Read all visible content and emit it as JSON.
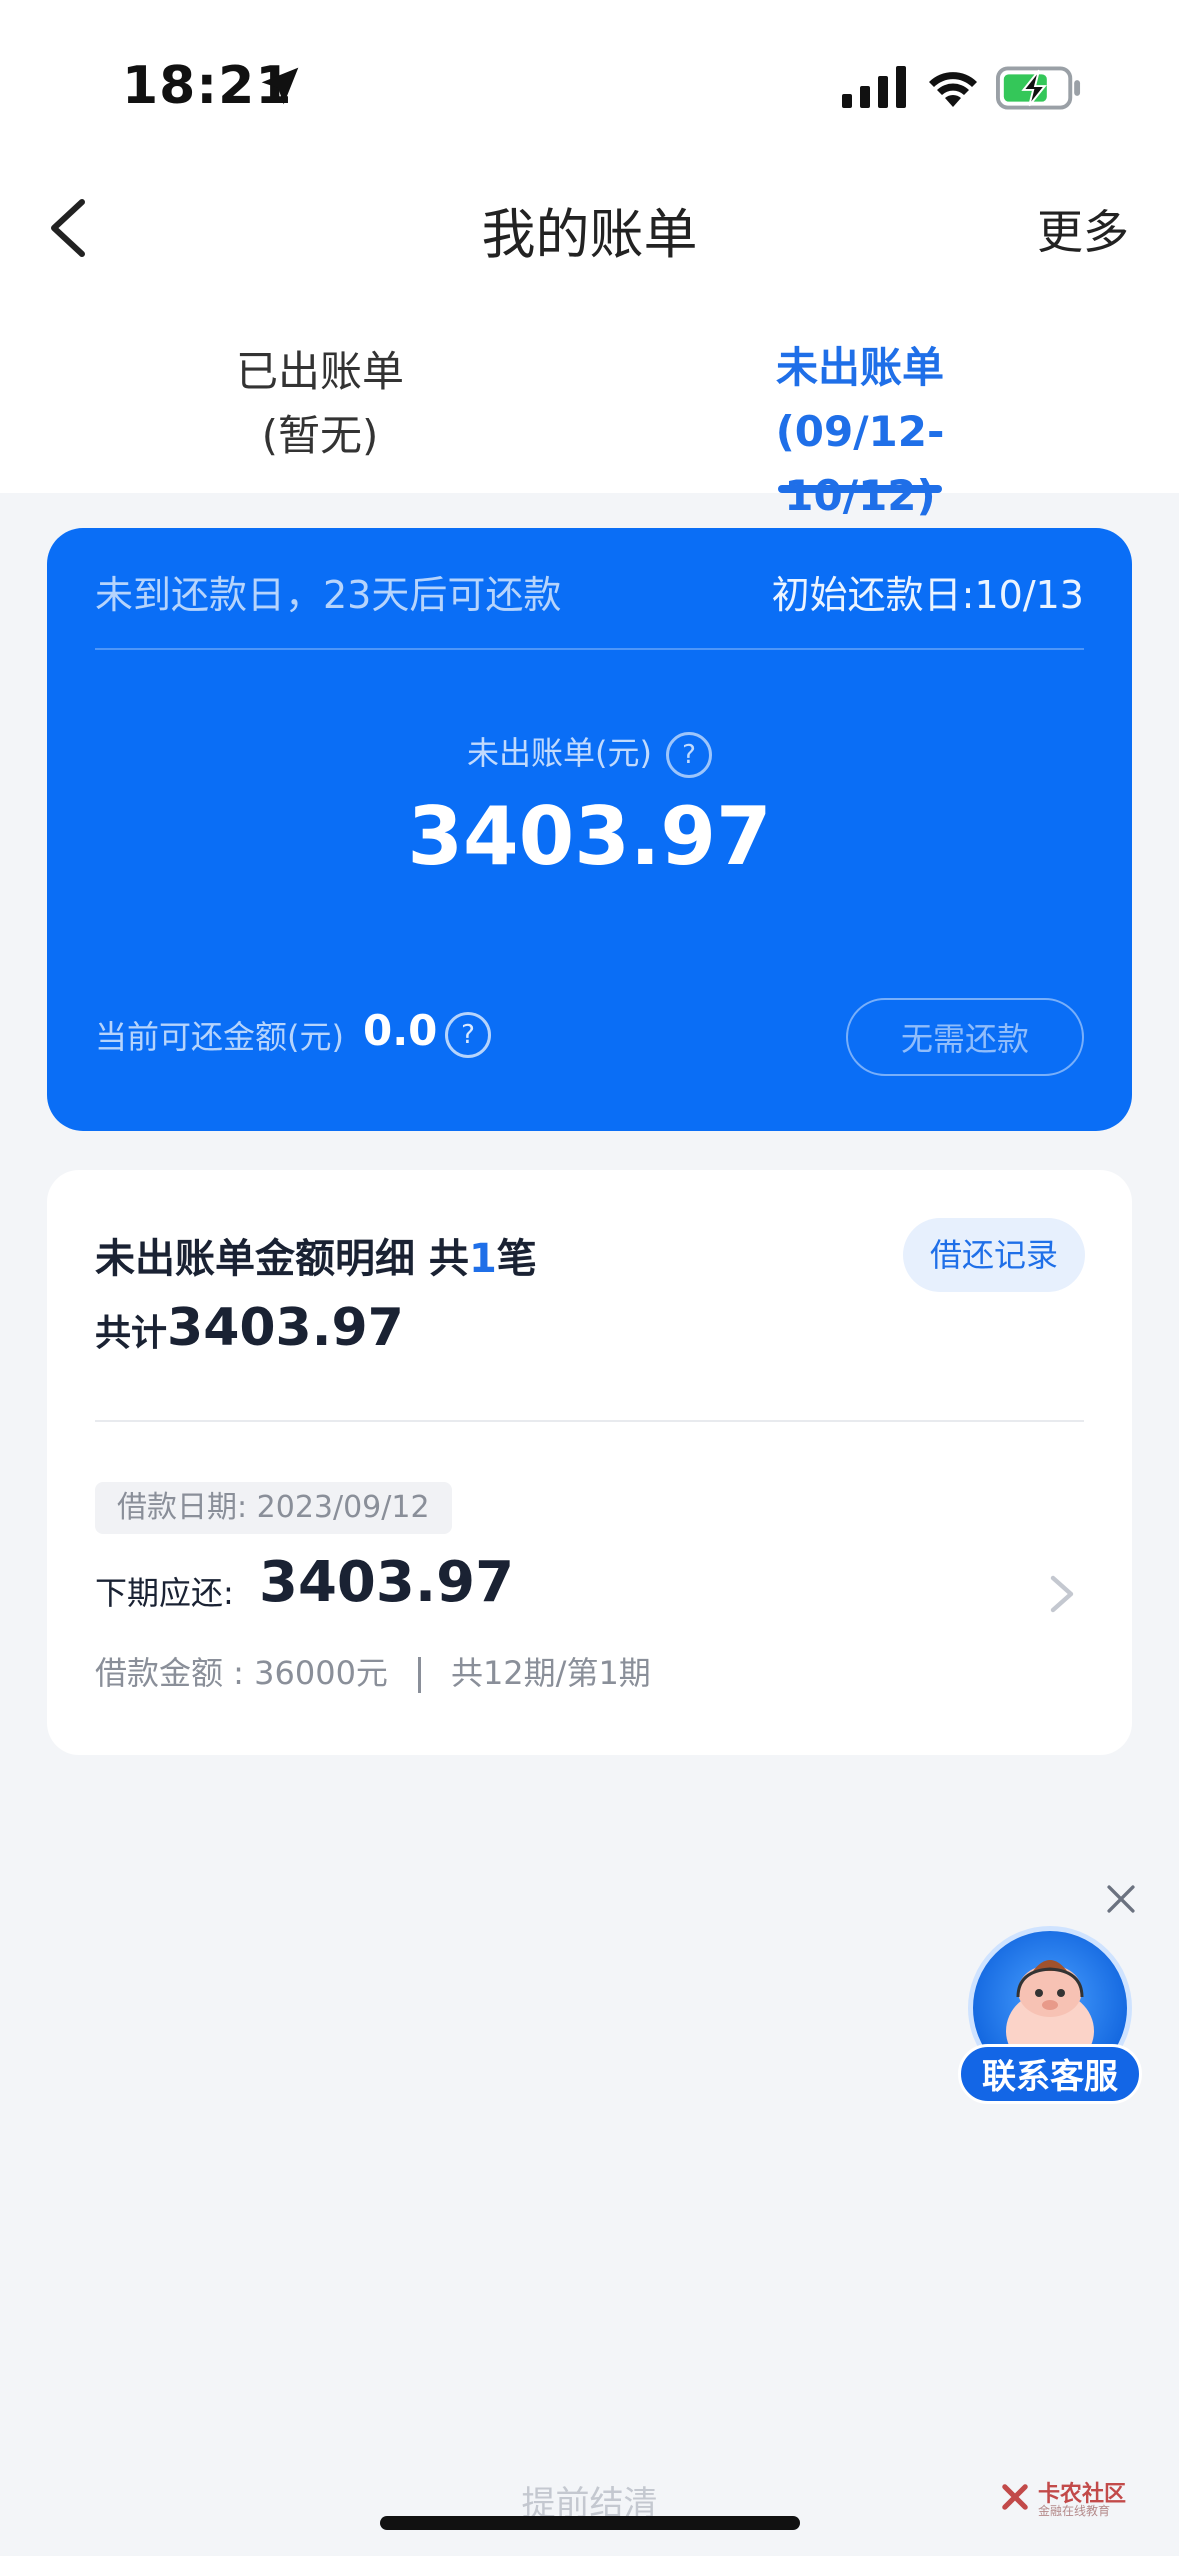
{
  "status_bar": {
    "time": "18:21"
  },
  "nav": {
    "title": "我的账单",
    "more": "更多"
  },
  "tabs": [
    {
      "line1": "已出账单",
      "line2": "(暂无)",
      "active": false
    },
    {
      "line1": "未出账单",
      "line2": "(09/12-10/12)",
      "active": true
    }
  ],
  "summary_card": {
    "tip": "未到还款日，23天后可还款",
    "initial_repay_date": "初始还款日:10/13",
    "label": "未出账单(元)",
    "amount": "3403.97",
    "current_label": "当前可还金额(元)",
    "current_value": "0.0",
    "button": "无需还款",
    "help_glyph": "?"
  },
  "detail": {
    "title_prefix": "未出账单金额明细 共",
    "count": "1",
    "title_suffix": "笔",
    "total_label": "共计",
    "total_value": "3403.97",
    "record_button": "借还记录",
    "loan_date": "借款日期:   2023/09/12",
    "next_label": "下期应还:",
    "next_value": "3403.97",
    "loan_amount": "借款金额 :   36000元",
    "period": "共12期/第1期"
  },
  "service": {
    "label": "联系客服"
  },
  "bottom": {
    "prepay": "提前结清"
  },
  "watermark": {
    "text": "卡农社区",
    "sub": "金融在线教育"
  },
  "colors": {
    "accent": "#1f6fe8",
    "card": "#0a6ef6",
    "background": "#f3f5f8"
  }
}
